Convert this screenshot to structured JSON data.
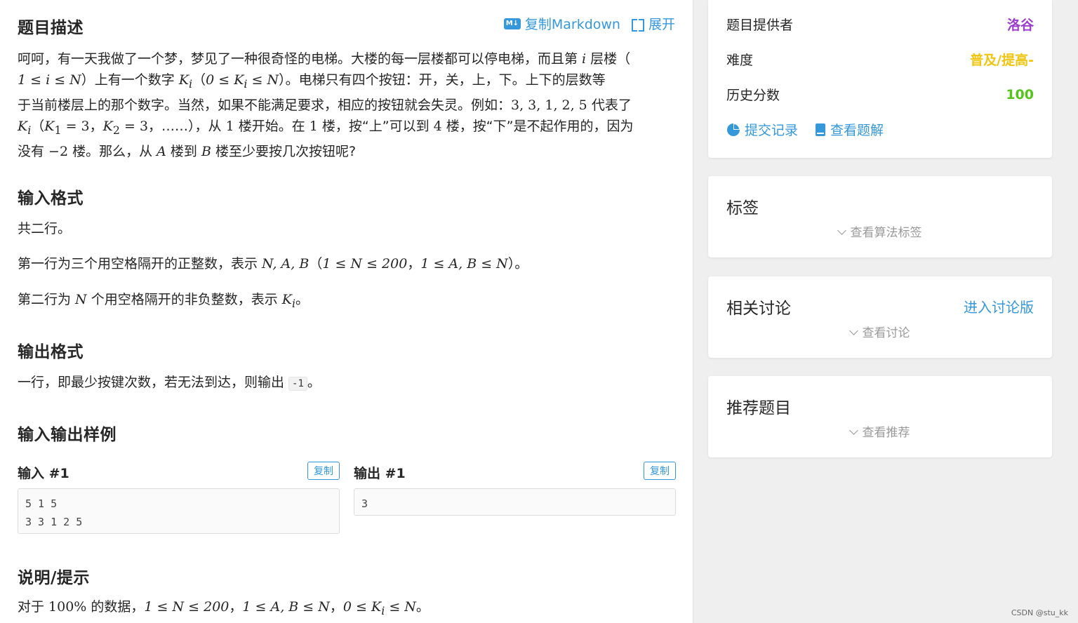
{
  "colors": {
    "accent": "#3498db",
    "provider": "#9d3dcf",
    "difficulty": "#f1c40f",
    "score": "#52c41a"
  },
  "toolbar": {
    "copy_markdown": "复制Markdown",
    "expand": "展开",
    "md_badge": "M↓"
  },
  "sections": {
    "description_title": "题目描述",
    "input_title": "输入格式",
    "output_title": "输出格式",
    "samples_title": "输入输出样例",
    "hint_title": "说明/提示"
  },
  "description": {
    "l1a": "呵呵，有一天我做了一个梦，梦见了一种很奇怪的电梯。大楼的每一层楼都可以停电梯，而且第 ",
    "l1m": "i",
    "l1b": " 层楼（",
    "l2m1": "1 ≤ i ≤ N",
    "l2a": "）上有一个数字 ",
    "l2m2": "K",
    "l2sub": "i",
    "l2b": "（",
    "l2m3": "0 ≤ K",
    "l2m3sub": "i",
    "l2m4": " ≤ N",
    "l2c": "）。电梯只有四个按钮：开，关，上，下。上下的层数等",
    "l3a": "于当前楼层上的那个数字。当然，如果不能满足要求，相应的按钮就会失灵。例如：",
    "l3m": "3, 3, 1, 2, 5",
    "l3b": " 代表了",
    "l4m1": "K",
    "l4sub1": "i",
    "l4a": "（",
    "l4m2": "K",
    "l4sub2": "1",
    "l4m3": " = 3",
    "l4b": "，",
    "l4m4": "K",
    "l4sub4": "2",
    "l4m5": " = 3",
    "l4c": "，……），从 ",
    "l4m6": "1",
    "l4d": " 楼开始。在 ",
    "l4m7": "1",
    "l4e": " 楼，按“上”可以到 ",
    "l4m8": "4",
    "l4f": " 楼，按“下”是不起作用的，因为",
    "l5a": "没有 ",
    "l5m1": "−2",
    "l5b": " 楼。那么，从 ",
    "l5m2": "A",
    "l5c": " 楼到 ",
    "l5m3": "B",
    "l5d": " 楼至少要按几次按钮呢?"
  },
  "input_format": {
    "p1": "共二行。",
    "p2a": "第一行为三个用空格隔开的正整数，表示 ",
    "p2m1": "N, A, B",
    "p2b": "（",
    "p2m2": "1 ≤ N ≤ 200",
    "p2c": "，",
    "p2m3": "1 ≤ A, B ≤ N",
    "p2d": "）。",
    "p3a": "第二行为 ",
    "p3m1": "N",
    "p3b": " 个用空格隔开的非负整数，表示 ",
    "p3m2": "K",
    "p3sub": "i",
    "p3c": "。"
  },
  "output_format": {
    "p1a": "一行，即最少按键次数，若无法到达，则输出 ",
    "code": "-1",
    "p1b": "。"
  },
  "samples": {
    "input_label": "输入 #1",
    "output_label": "输出 #1",
    "copy": "复制",
    "input_text": "5 1 5\n3 3 1 2 5",
    "output_text": "3"
  },
  "hint": {
    "a": "对于 ",
    "m1": "100%",
    "b": " 的数据，",
    "m2": "1 ≤ N ≤ 200",
    "c": "，",
    "m3": "1 ≤ A, B ≤ N",
    "d": "，",
    "m4": "0 ≤ K",
    "m4sub": "i",
    "m5": " ≤ N",
    "e": "。"
  },
  "sidebar": {
    "info": {
      "provider_label": "题目提供者",
      "provider": "洛谷",
      "difficulty_label": "难度",
      "difficulty": "普及/提高-",
      "score_label": "历史分数",
      "score": "100",
      "submissions": "提交记录",
      "solutions": "查看题解"
    },
    "tags": {
      "title": "标签",
      "expand": "查看算法标签"
    },
    "discuss": {
      "title": "相关讨论",
      "link": "进入讨论版",
      "expand": "查看讨论"
    },
    "recommend": {
      "title": "推荐题目",
      "expand": "查看推荐"
    }
  },
  "watermark": "CSDN @stu_kk"
}
